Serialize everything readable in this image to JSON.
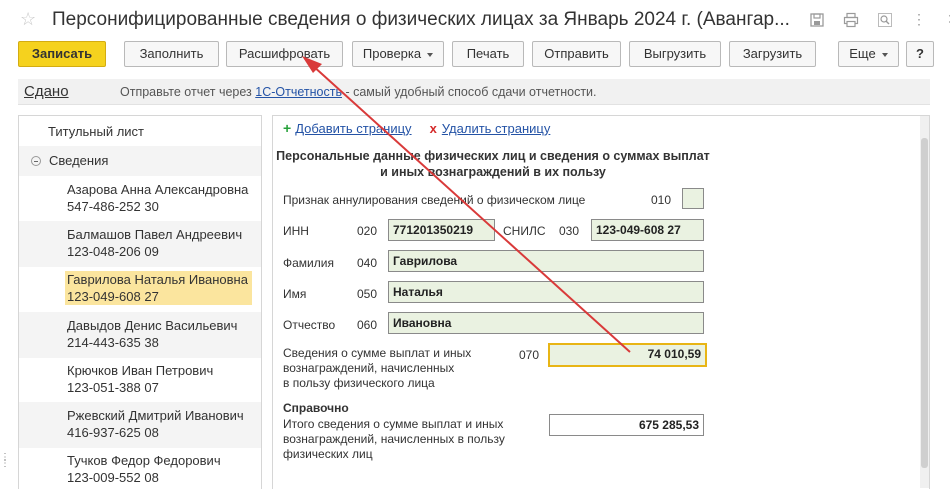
{
  "window": {
    "title": "Персонифицированные сведения о физических лицах за Январь 2024 г. (Авангар...",
    "icons": [
      "star-icon",
      "save-icon",
      "print-icon",
      "zoom-icon",
      "more-icon",
      "close-icon"
    ]
  },
  "toolbar": {
    "save_label": "Записать",
    "fill_label": "Заполнить",
    "decode_label": "Расшифровать",
    "check_label": "Проверка",
    "print_label": "Печать",
    "send_label": "Отправить",
    "export_label": "Выгрузить",
    "import_label": "Загрузить",
    "more_label": "Еще",
    "help_label": "?"
  },
  "status": {
    "state": "Сдано",
    "message_prefix": "Отправьте отчет через ",
    "message_link": "1С-Отчетность",
    "message_suffix": " - самый удобный способ сдачи отчетности."
  },
  "sidebar": {
    "title_page": "Титульный лист",
    "section": "Сведения",
    "persons": [
      {
        "name": "Азарова Анна Александровна",
        "snils": "547-486-252 30"
      },
      {
        "name": "Балмашов Павел Андреевич",
        "snils": "123-048-206 09"
      },
      {
        "name": "Гаврилова Наталья Ивановна",
        "snils": "123-049-608 27"
      },
      {
        "name": "Давыдов Денис Васильевич",
        "snils": "214-443-635 38"
      },
      {
        "name": "Крючков Иван Петрович",
        "snils": "123-051-388 07"
      },
      {
        "name": "Ржевский Дмитрий Иванович",
        "snils": "416-937-625 08"
      },
      {
        "name": "Тучков Федор Федорович",
        "snils": "123-009-552 08"
      }
    ]
  },
  "form": {
    "add_page": "Добавить страницу",
    "delete_page": "Удалить страницу",
    "heading": "Персональные данные физических лиц и сведения о суммах выплат и иных вознаграждений в их пользу",
    "cancel_label": "Признак аннулирования сведений о физическом лице",
    "cancel_code": "010",
    "inn_label": "ИНН",
    "inn_code": "020",
    "inn_value": "771201350219",
    "snils_label": "СНИЛС",
    "snils_code": "030",
    "snils_value": "123-049-608 27",
    "lastname_label": "Фамилия",
    "lastname_code": "040",
    "lastname_value": "Гаврилова",
    "firstname_label": "Имя",
    "firstname_code": "050",
    "firstname_value": "Наталья",
    "middlename_label": "Отчество",
    "middlename_code": "060",
    "middlename_value": "Ивановна",
    "payments_label_1": "Сведения о сумме выплат и иных",
    "payments_label_2": "вознаграждений, начисленных",
    "payments_label_3": "в пользу физического лица",
    "payments_code": "070",
    "payments_value": "74 010,59",
    "reference_title": "Справочно",
    "total_label_1": "Итого сведения о сумме выплат и иных",
    "total_label_2": "вознаграждений, начисленных в пользу",
    "total_label_3": "физических лиц",
    "total_value": "675 285,53"
  },
  "colors": {
    "primary_button": "#f5d21e",
    "field_bg": "#eaf2e1",
    "selected_row": "#fbe59e",
    "focus_border": "#e8b515",
    "arrow": "#d93a3a",
    "link": "#2453a6"
  }
}
